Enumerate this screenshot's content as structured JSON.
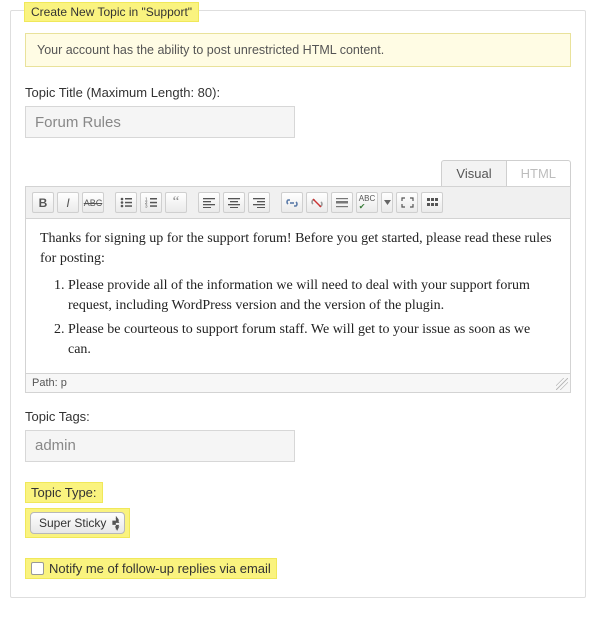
{
  "legend": "Create New Topic in \"Support\"",
  "notice": "Your account has the ability to post unrestricted HTML content.",
  "title_field": {
    "label": "Topic Title (Maximum Length: 80):",
    "value": "Forum Rules"
  },
  "tabs": {
    "visual": "Visual",
    "html": "HTML",
    "active": "visual"
  },
  "toolbar_buttons": [
    "bold",
    "italic",
    "strike",
    "sep",
    "ul",
    "ol",
    "quote",
    "sep",
    "align-left",
    "align-center",
    "align-right",
    "sep",
    "link",
    "unlink",
    "break",
    "spellcheck",
    "dropdown",
    "fullscreen",
    "kitchen-sink"
  ],
  "editor": {
    "intro": "Thanks for signing up for the support forum! Before you get started, please read these rules for posting:",
    "rules": [
      "Please provide all of the information we will need to deal with your support forum request, including WordPress version and the version of the plugin.",
      "Please be courteous to support forum staff. We will get to your issue as soon as we can."
    ],
    "path_label": "Path:",
    "path_value": "p"
  },
  "tags_field": {
    "label": "Topic Tags:",
    "value": "admin"
  },
  "type_field": {
    "label": "Topic Type:",
    "value": "Super Sticky"
  },
  "notify": {
    "label": "Notify me of follow-up replies via email",
    "checked": false
  }
}
